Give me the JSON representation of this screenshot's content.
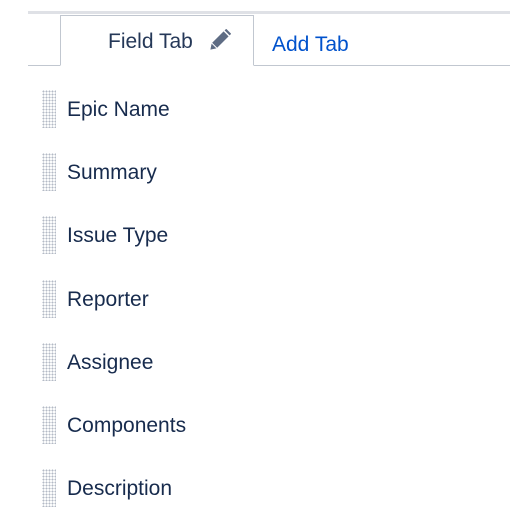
{
  "tabs": {
    "active_tab_label": "Field Tab",
    "edit_icon": "pencil-icon",
    "add_tab_label": "Add Tab"
  },
  "fields": [
    {
      "label": "Epic Name"
    },
    {
      "label": "Summary"
    },
    {
      "label": "Issue Type"
    },
    {
      "label": "Reporter"
    },
    {
      "label": "Assignee"
    },
    {
      "label": "Components"
    },
    {
      "label": "Description"
    }
  ],
  "colors": {
    "link": "#0052cc",
    "text": "#172b4d",
    "border": "#c1c7d0",
    "handle": "#b3bac5"
  }
}
